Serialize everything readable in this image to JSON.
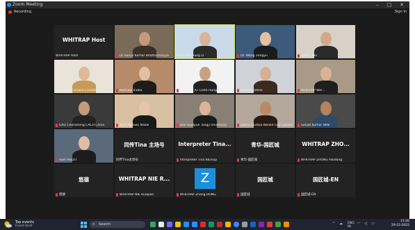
{
  "window": {
    "title": "Zoom Meeting",
    "minimize": "–",
    "maximize": "□",
    "close": "✕"
  },
  "recording": {
    "label": "Recording"
  },
  "signin": "Sign In",
  "tiles": [
    {
      "name": "WHITRAP Host",
      "label": "WHITRAP Host",
      "type": "text"
    },
    {
      "name": "Dr Sanjiv Kumar Bhattacharyya",
      "type": "cam",
      "muted": true
    },
    {
      "name": "WHITRAP Hung LI",
      "type": "cam",
      "active": true
    },
    {
      "name": "Dr. Wang Zengyu",
      "type": "cam",
      "muted": true
    },
    {
      "name": "ZHOU Wei",
      "type": "cam",
      "muted": true
    },
    {
      "name": "WHITRAP Caroline Castellanos",
      "type": "cam"
    },
    {
      "name": "Natsuko Inaba",
      "type": "cam",
      "muted": true
    },
    {
      "name": "ICOMOS_Ar. Clete Hung Huat, Mal...",
      "type": "cam",
      "muted": true
    },
    {
      "name": "Paula Castello",
      "type": "cam",
      "muted": true
    },
    {
      "name": "WHITRAP Wei...",
      "type": "cam",
      "muted": true
    },
    {
      "name": "GAO Chensheng CACH China",
      "type": "cam",
      "muted": true
    },
    {
      "name": "WEN Mitsuki Mazal",
      "type": "cam",
      "muted": true
    },
    {
      "name": "Roe Hualyun Tongji University",
      "type": "cam",
      "muted": true
    },
    {
      "name": "Salma Qudsia-Walled City Lahore",
      "type": "cam",
      "muted": true
    },
    {
      "name": "Sanjat Kumar IWN",
      "type": "cam",
      "muted": true
    },
    {
      "name": "Sam VELOT",
      "type": "cam",
      "muted": true
    },
    {
      "name": "同传Tina主场号",
      "label": "同传Tina 主场号",
      "type": "text"
    },
    {
      "name": "Interpreter Tina Backup",
      "label": "Interpreter Tina...",
      "type": "text",
      "muted": true
    },
    {
      "name": "青华-国匠城",
      "label": "青华-国匠城",
      "type": "text",
      "muted": true
    },
    {
      "name": "WHITRAP ZHONG Haidong",
      "label": "WHITRAP ZHO...",
      "type": "text",
      "muted": true
    },
    {
      "name": "悠德",
      "label": "悠德",
      "type": "text",
      "muted": true
    },
    {
      "name": "WHITRAP NIE Ruiquan",
      "label": "WHITRAP NIE R...",
      "type": "text",
      "muted": true
    },
    {
      "name": "WHITRAP Zhang DONG",
      "label": "Z",
      "type": "avatar",
      "muted": true
    },
    {
      "name": "国匠城",
      "label": "国匠城",
      "type": "text",
      "muted": true
    },
    {
      "name": "国匠城-EN",
      "label": "国匠城-EN",
      "type": "text",
      "muted": true
    }
  ],
  "taskbar": {
    "weather_title": "Top events",
    "weather_sub": "Event brief",
    "search_placeholder": "Search",
    "lang": "ENG",
    "region": "IN",
    "time": "11:20",
    "date": "29-12-2022"
  },
  "colors": {
    "zoom_blue": "#2d8cff",
    "mic_red": "#e53935",
    "active_outline": "#cfe067",
    "avatar_blue": "#1e8ed8"
  }
}
